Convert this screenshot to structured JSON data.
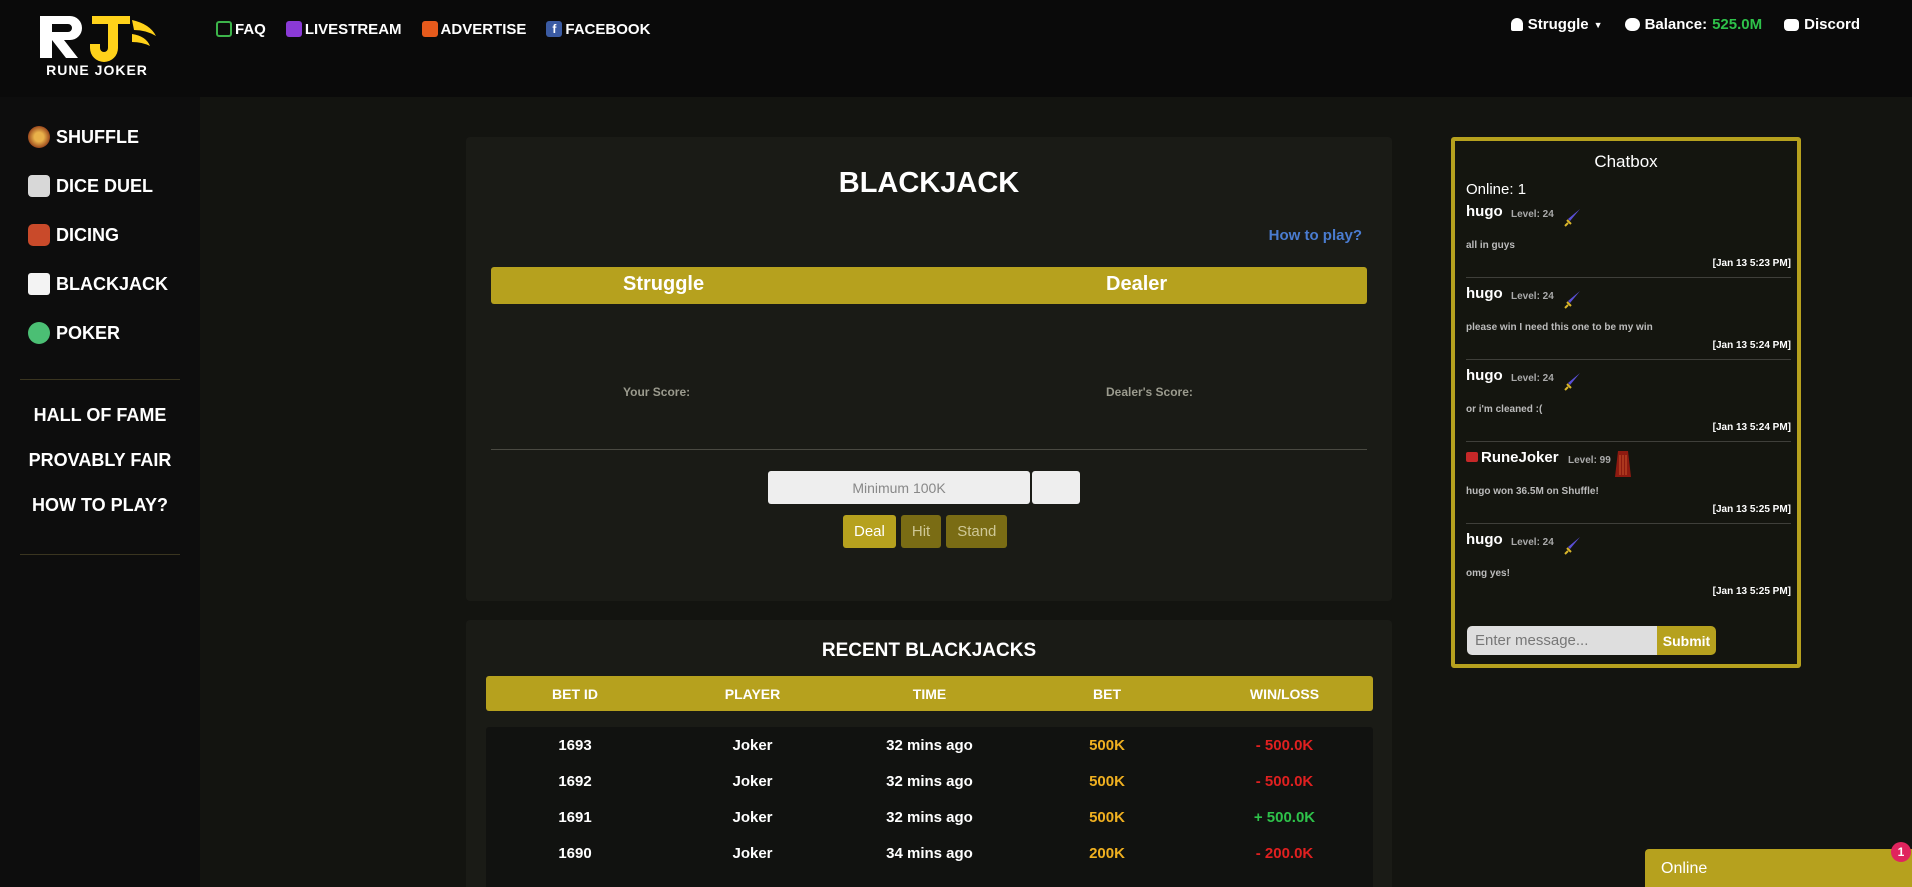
{
  "header": {
    "logo_text": "RUNE JOKER",
    "nav": [
      {
        "label": "FAQ",
        "icon": "question-icon"
      },
      {
        "label": "LIVESTREAM",
        "icon": "twitch-icon"
      },
      {
        "label": "ADVERTISE",
        "icon": "megaphone-icon"
      },
      {
        "label": "FACEBOOK",
        "icon": "facebook-icon"
      }
    ],
    "user": {
      "name": "Struggle",
      "balance_label": "Balance:",
      "balance_value": "525.0M",
      "discord_label": "Discord"
    }
  },
  "sidebar": {
    "games": [
      {
        "label": "SHUFFLE",
        "icon": "shuffle-icon"
      },
      {
        "label": "DICE DUEL",
        "icon": "dice-duel-icon"
      },
      {
        "label": "DICING",
        "icon": "dice-icon"
      },
      {
        "label": "BLACKJACK",
        "icon": "cards-icon"
      },
      {
        "label": "POKER",
        "icon": "poker-chip-icon"
      }
    ],
    "info": [
      "HALL OF FAME",
      "PROVABLY FAIR",
      "HOW TO PLAY?"
    ]
  },
  "blackjack": {
    "title": "BLACKJACK",
    "how_to_play": "How to play?",
    "player_label": "Struggle",
    "dealer_label": "Dealer",
    "your_score_label": "Your Score:",
    "dealer_score_label": "Dealer's Score:",
    "bet_placeholder": "Minimum 100K",
    "deal_label": "Deal",
    "hit_label": "Hit",
    "stand_label": "Stand"
  },
  "recent": {
    "title": "RECENT BLACKJACKS",
    "headers": [
      "BET ID",
      "PLAYER",
      "TIME",
      "BET",
      "WIN/LOSS"
    ],
    "rows": [
      {
        "id": "1693",
        "player": "Joker",
        "time": "32 mins ago",
        "bet": "500K",
        "result": "- 500.0K",
        "win": false
      },
      {
        "id": "1692",
        "player": "Joker",
        "time": "32 mins ago",
        "bet": "500K",
        "result": "- 500.0K",
        "win": false
      },
      {
        "id": "1691",
        "player": "Joker",
        "time": "32 mins ago",
        "bet": "500K",
        "result": "+ 500.0K",
        "win": true
      },
      {
        "id": "1690",
        "player": "Joker",
        "time": "34 mins ago",
        "bet": "200K",
        "result": "- 200.0K",
        "win": false
      }
    ]
  },
  "chat": {
    "title": "Chatbox",
    "online": "Online: 1",
    "messages": [
      {
        "name": "hugo",
        "level": "Level: 24",
        "text": "all in guys",
        "time": "[Jan 13 5:23 PM]",
        "weapon": "sword-icon"
      },
      {
        "name": "hugo",
        "level": "Level: 24",
        "text": "please win I need this one to be my win",
        "time": "[Jan 13 5:24 PM]",
        "weapon": "sword-icon"
      },
      {
        "name": "hugo",
        "level": "Level: 24",
        "text": "or i'm cleaned :(",
        "time": "[Jan 13 5:24 PM]",
        "weapon": "sword-icon"
      },
      {
        "name": "RuneJoker",
        "level": "Level: 99",
        "text": "hugo won 36.5M on Shuffle!",
        "time": "[Jan 13 5:25 PM]",
        "weapon": "cape-icon"
      },
      {
        "name": "hugo",
        "level": "Level: 24",
        "text": "omg yes!",
        "time": "[Jan 13 5:25 PM]",
        "weapon": "sword-icon"
      }
    ],
    "input_placeholder": "Enter message...",
    "submit_label": "Submit"
  },
  "online_widget": {
    "label": "Online",
    "badge": "1"
  },
  "colors": {
    "accent": "#b6a11e",
    "balance": "#2ec24a",
    "loss": "#e02020",
    "win": "#2ec24a",
    "bet": "#f0b020"
  }
}
